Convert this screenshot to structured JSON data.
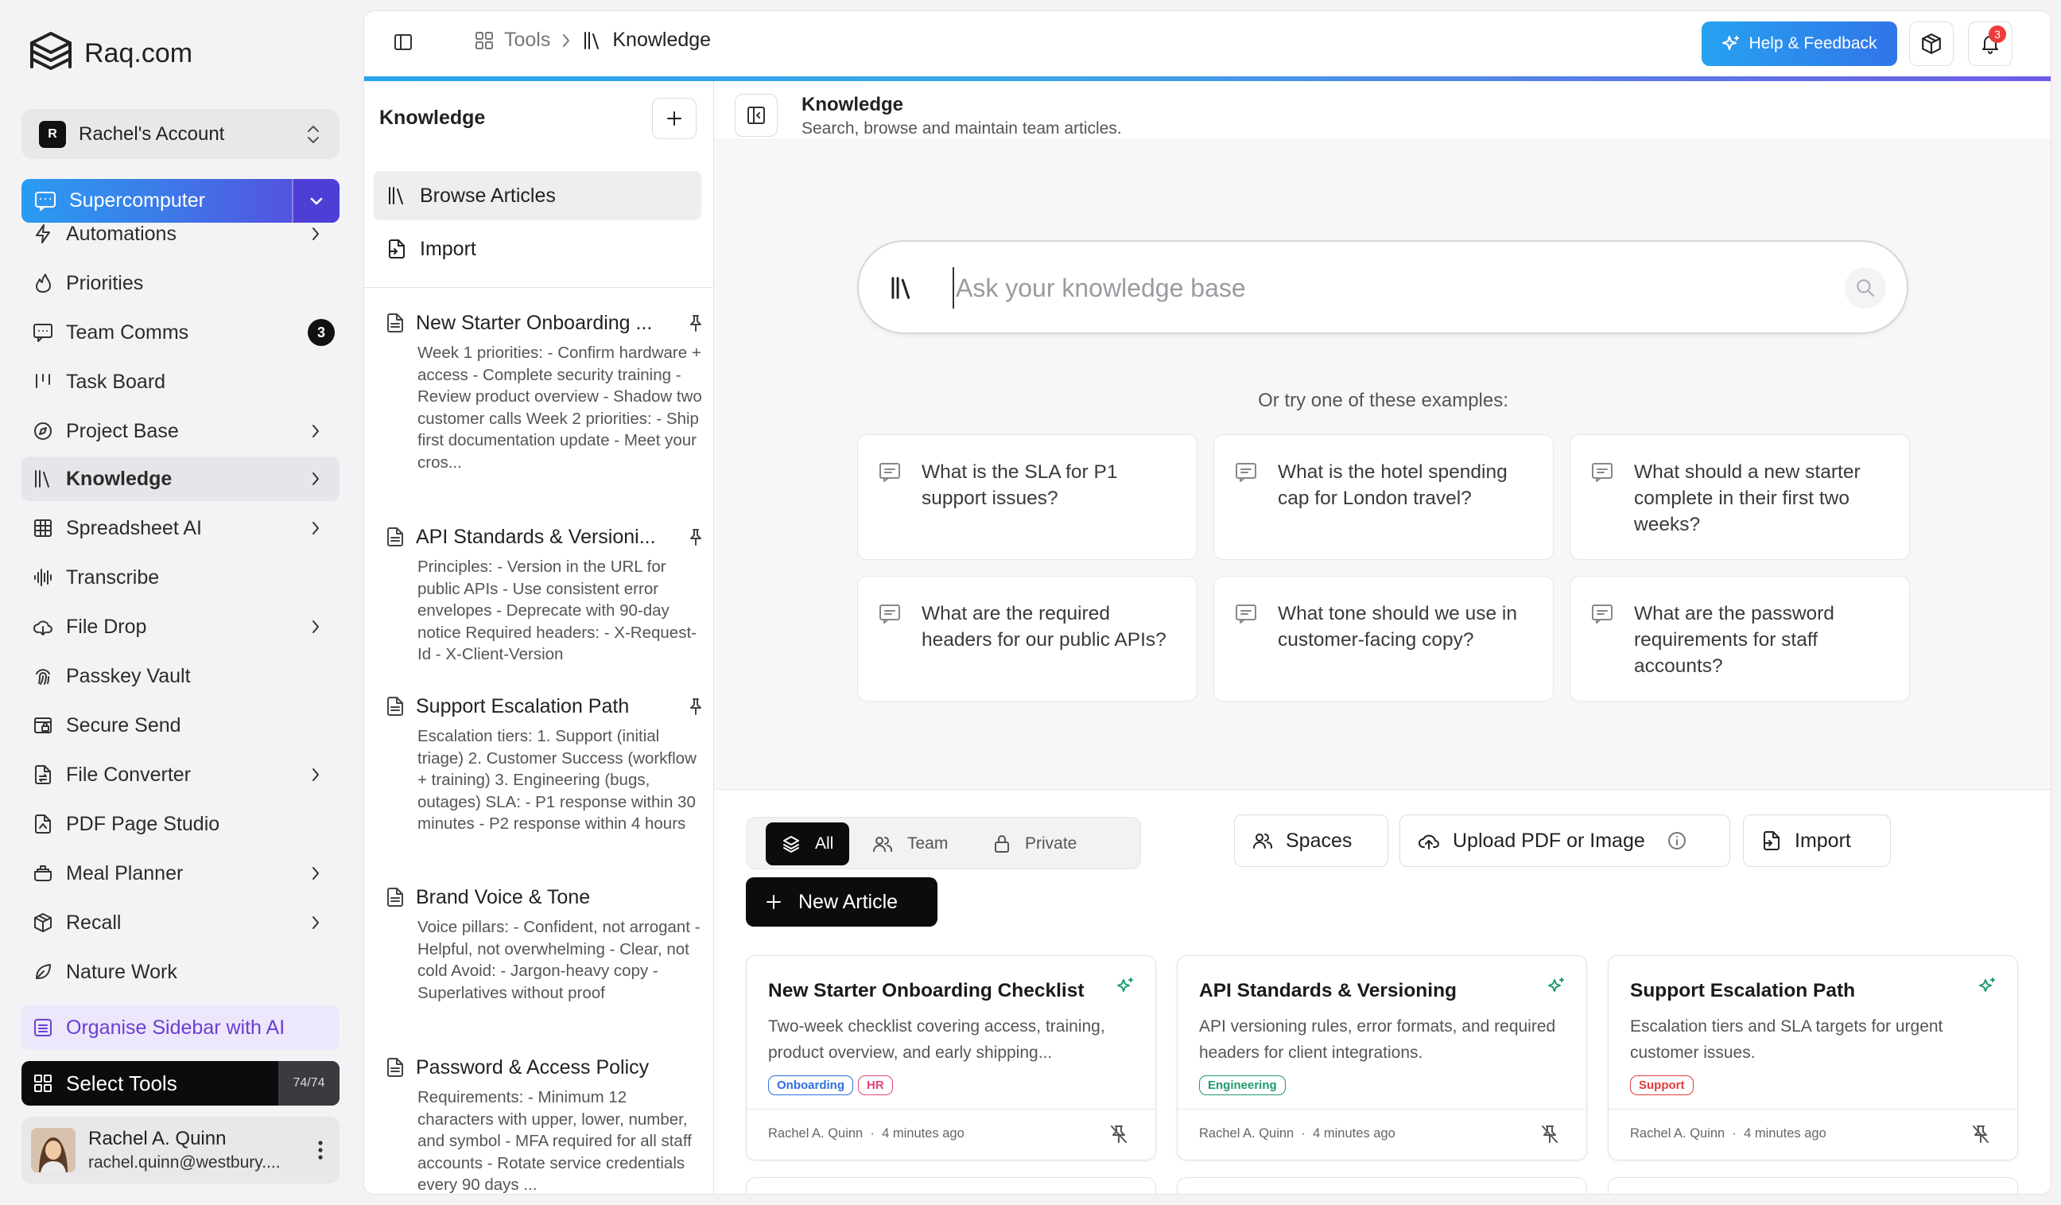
{
  "brand": {
    "name": "Raq.com"
  },
  "account": {
    "badge": "R",
    "name": "Rachel's Account"
  },
  "supercomputer": {
    "label": "Supercomputer"
  },
  "sidebar": {
    "items": [
      {
        "label": "Automations",
        "icon": "bolt-icon"
      },
      {
        "label": "Priorities",
        "icon": "flame-icon"
      },
      {
        "label": "Team Comms",
        "icon": "chat-icon",
        "badge": "3"
      },
      {
        "label": "Task Board",
        "icon": "kanban-icon"
      },
      {
        "label": "Project Base",
        "icon": "compass-icon"
      },
      {
        "label": "Knowledge",
        "icon": "library-icon"
      },
      {
        "label": "Spreadsheet AI",
        "icon": "grid-icon"
      },
      {
        "label": "Transcribe",
        "icon": "waveform-icon"
      },
      {
        "label": "File Drop",
        "icon": "cloud-icon"
      },
      {
        "label": "Passkey Vault",
        "icon": "fingerprint-icon"
      },
      {
        "label": "Secure Send",
        "icon": "secure-send-icon"
      },
      {
        "label": "File Converter",
        "icon": "file-convert-icon"
      },
      {
        "label": "PDF Page Studio",
        "icon": "pdf-icon"
      },
      {
        "label": "Meal Planner",
        "icon": "cooking-pot-icon"
      },
      {
        "label": "Recall",
        "icon": "recall-icon"
      },
      {
        "label": "Nature Work",
        "icon": "leaf-icon"
      }
    ],
    "organise_label": "Organise Sidebar with AI",
    "select_tools_label": "Select Tools",
    "select_tools_count": "74/74"
  },
  "user": {
    "name": "Rachel A. Quinn",
    "email": "rachel.quinn@westbury...."
  },
  "topbar": {
    "crumb_tools": "Tools",
    "crumb_current": "Knowledge",
    "help_label": "Help & Feedback",
    "notification_count": "3"
  },
  "knowledge_panel": {
    "title": "Knowledge",
    "browse_label": "Browse Articles",
    "import_label": "Import",
    "articles": [
      {
        "title": "New Starter Onboarding ...",
        "excerpt": "Week 1 priorities: - Confirm hardware + access - Complete security training - Review product overview - Shadow two customer calls Week 2 priorities: - Ship first documentation update - Meet your cros..."
      },
      {
        "title": "API Standards & Versioni...",
        "excerpt": "Principles: - Version in the URL for public APIs - Use consistent error envelopes - Deprecate with 90-day notice Required headers: - X-Request-Id - X-Client-Version"
      },
      {
        "title": "Support Escalation Path",
        "excerpt": "Escalation tiers: 1. Support (initial triage) 2. Customer Success (workflow + training) 3. Engineering (bugs, outages) SLA: - P1 response within 30 minutes - P2 response within 4 hours"
      },
      {
        "title": "Brand Voice & Tone",
        "excerpt": "Voice pillars: - Confident, not arrogant - Helpful, not overwhelming - Clear, not cold Avoid: - Jargon-heavy copy - Superlatives without proof"
      },
      {
        "title": "Password & Access Policy",
        "excerpt": "Requirements: - Minimum 12 characters with upper, lower, number, and symbol - MFA required for all staff accounts - Rotate service credentials every 90 days ..."
      }
    ]
  },
  "content": {
    "title": "Knowledge",
    "subtitle": "Search, browse and maintain team articles.",
    "search_placeholder": "Ask your knowledge base",
    "examples_label": "Or try one of these examples:",
    "examples": [
      "What is the SLA for P1 support issues?",
      "What is the hotel spending cap for London travel?",
      "What should a new starter complete in their first two weeks?",
      "What are the required headers for our public APIs?",
      "What tone should we use in customer-facing copy?",
      "What are the password requirements for staff accounts?"
    ],
    "filters": {
      "all": "All",
      "team": "Team",
      "private": "Private"
    },
    "spaces_label": "Spaces",
    "upload_label": "Upload PDF or Image",
    "import_label": "Import",
    "new_article_label": "New Article"
  },
  "article_cards": [
    {
      "title": "New Starter Onboarding Checklist",
      "description": "Two-week checklist covering access, training, product overview, and early shipping...",
      "tags": [
        {
          "label": "Onboarding",
          "color": "#2f6fe0"
        },
        {
          "label": "HR",
          "color": "#e0467a"
        }
      ],
      "author": "Rachel A. Quinn",
      "time": "4 minutes ago"
    },
    {
      "title": "API Standards & Versioning",
      "description": "API versioning rules, error formats, and required headers for client integrations.",
      "tags": [
        {
          "label": "Engineering",
          "color": "#1e9b6a"
        }
      ],
      "author": "Rachel A. Quinn",
      "time": "4 minutes ago"
    },
    {
      "title": "Support Escalation Path",
      "description": "Escalation tiers and SLA targets for urgent customer issues.",
      "tags": [
        {
          "label": "Support",
          "color": "#e03b3b"
        }
      ],
      "author": "Rachel A. Quinn",
      "time": "4 minutes ago"
    }
  ],
  "colors": {
    "accent_blue": "#2a9cf2",
    "accent_purple": "#5b45dc",
    "organise_purple": "#6b3fd1",
    "spark_green": "#1e9b6a"
  }
}
